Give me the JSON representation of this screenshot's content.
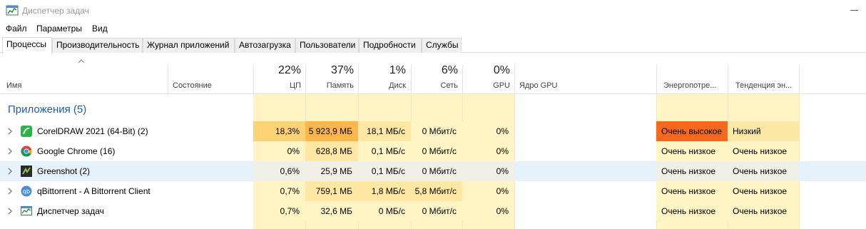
{
  "window": {
    "title": "Диспетчер задач",
    "app_icon": "task-manager-icon"
  },
  "menu": [
    "Файл",
    "Параметры",
    "Вид"
  ],
  "tabs": [
    "Процессы",
    "Производительность",
    "Журнал приложений",
    "Автозагрузка",
    "Пользователи",
    "Подробности",
    "Службы"
  ],
  "active_tab": "Процессы",
  "columns": {
    "name": "Имя",
    "status": "Состояние",
    "cpu": {
      "pct": "22%",
      "label": "ЦП"
    },
    "memory": {
      "pct": "37%",
      "label": "Память"
    },
    "disk": {
      "pct": "1%",
      "label": "Диск"
    },
    "network": {
      "pct": "6%",
      "label": "Сеть"
    },
    "gpu": {
      "pct": "0%",
      "label": "GPU"
    },
    "gpu_engine": "Ядро GPU",
    "power": "Энергопотре...",
    "power_trend": "Тенденция эн..."
  },
  "group": {
    "title": "Приложения (5)"
  },
  "rows": [
    {
      "name": "CorelDRAW 2021 (64-Bit) (2)",
      "icon": "coreldraw-icon",
      "cpu": "18,3%",
      "memory": "5 923,9 МБ",
      "disk": "18,1 МБ/с",
      "network": "0 Мбит/с",
      "gpu": "0%",
      "power": "Очень высокое",
      "trend": "Низкий"
    },
    {
      "name": "Google Chrome (16)",
      "icon": "chrome-icon",
      "cpu": "0%",
      "memory": "628,8 МБ",
      "disk": "0,1 МБ/с",
      "network": "0 Мбит/с",
      "gpu": "0%",
      "power": "Очень низкое",
      "trend": "Очень низкое"
    },
    {
      "name": "Greenshot (2)",
      "icon": "greenshot-icon",
      "cpu": "0,6%",
      "memory": "25,9 МБ",
      "disk": "0,1 МБ/с",
      "network": "0 Мбит/с",
      "gpu": "0%",
      "power": "Очень низкое",
      "trend": "Очень низкое"
    },
    {
      "name": "qBittorrent - A Bittorrent Client",
      "icon": "qbittorrent-icon",
      "cpu": "0,7%",
      "memory": "759,1 МБ",
      "disk": "1,8 МБ/с",
      "network": "5,8 Мбит/с",
      "gpu": "0%",
      "power": "Очень низкое",
      "trend": "Очень низкое"
    },
    {
      "name": "Диспетчер задач",
      "icon": "task-manager-icon",
      "cpu": "0,7%",
      "memory": "32,6 МБ",
      "disk": "0 МБ/с",
      "network": "0 Мбит/с",
      "gpu": "0%",
      "power": "Очень низкое",
      "trend": "Очень низкое"
    }
  ],
  "colors": {
    "heat_light": "#fff4c4",
    "heat_medium": "#ffe8a3",
    "heat_high": "#ffd375",
    "heat_higher": "#ffb74d",
    "power_very_high": "#f7681f",
    "trend_low": "#fde8a6",
    "selected_row": "#e5f1fb",
    "group_title": "#1f5fa8"
  }
}
